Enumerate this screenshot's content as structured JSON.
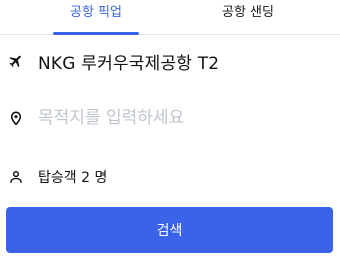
{
  "tabs": {
    "pickup_label": "공항 픽업",
    "dropoff_label": "공항 샌딩",
    "active": "pickup"
  },
  "pickup": {
    "location": "NKG 루커우국제공항 T2",
    "icon": "airplane-icon"
  },
  "destination": {
    "value": "",
    "placeholder": "목적지를 입력하세요",
    "icon": "location-pin-icon"
  },
  "passengers": {
    "label": "탑승객 2 명",
    "icon": "person-icon"
  },
  "search_button": {
    "label": "검색"
  },
  "colors": {
    "accent": "#3a63e8",
    "placeholder": "#bfc4cc",
    "text": "#111111"
  }
}
